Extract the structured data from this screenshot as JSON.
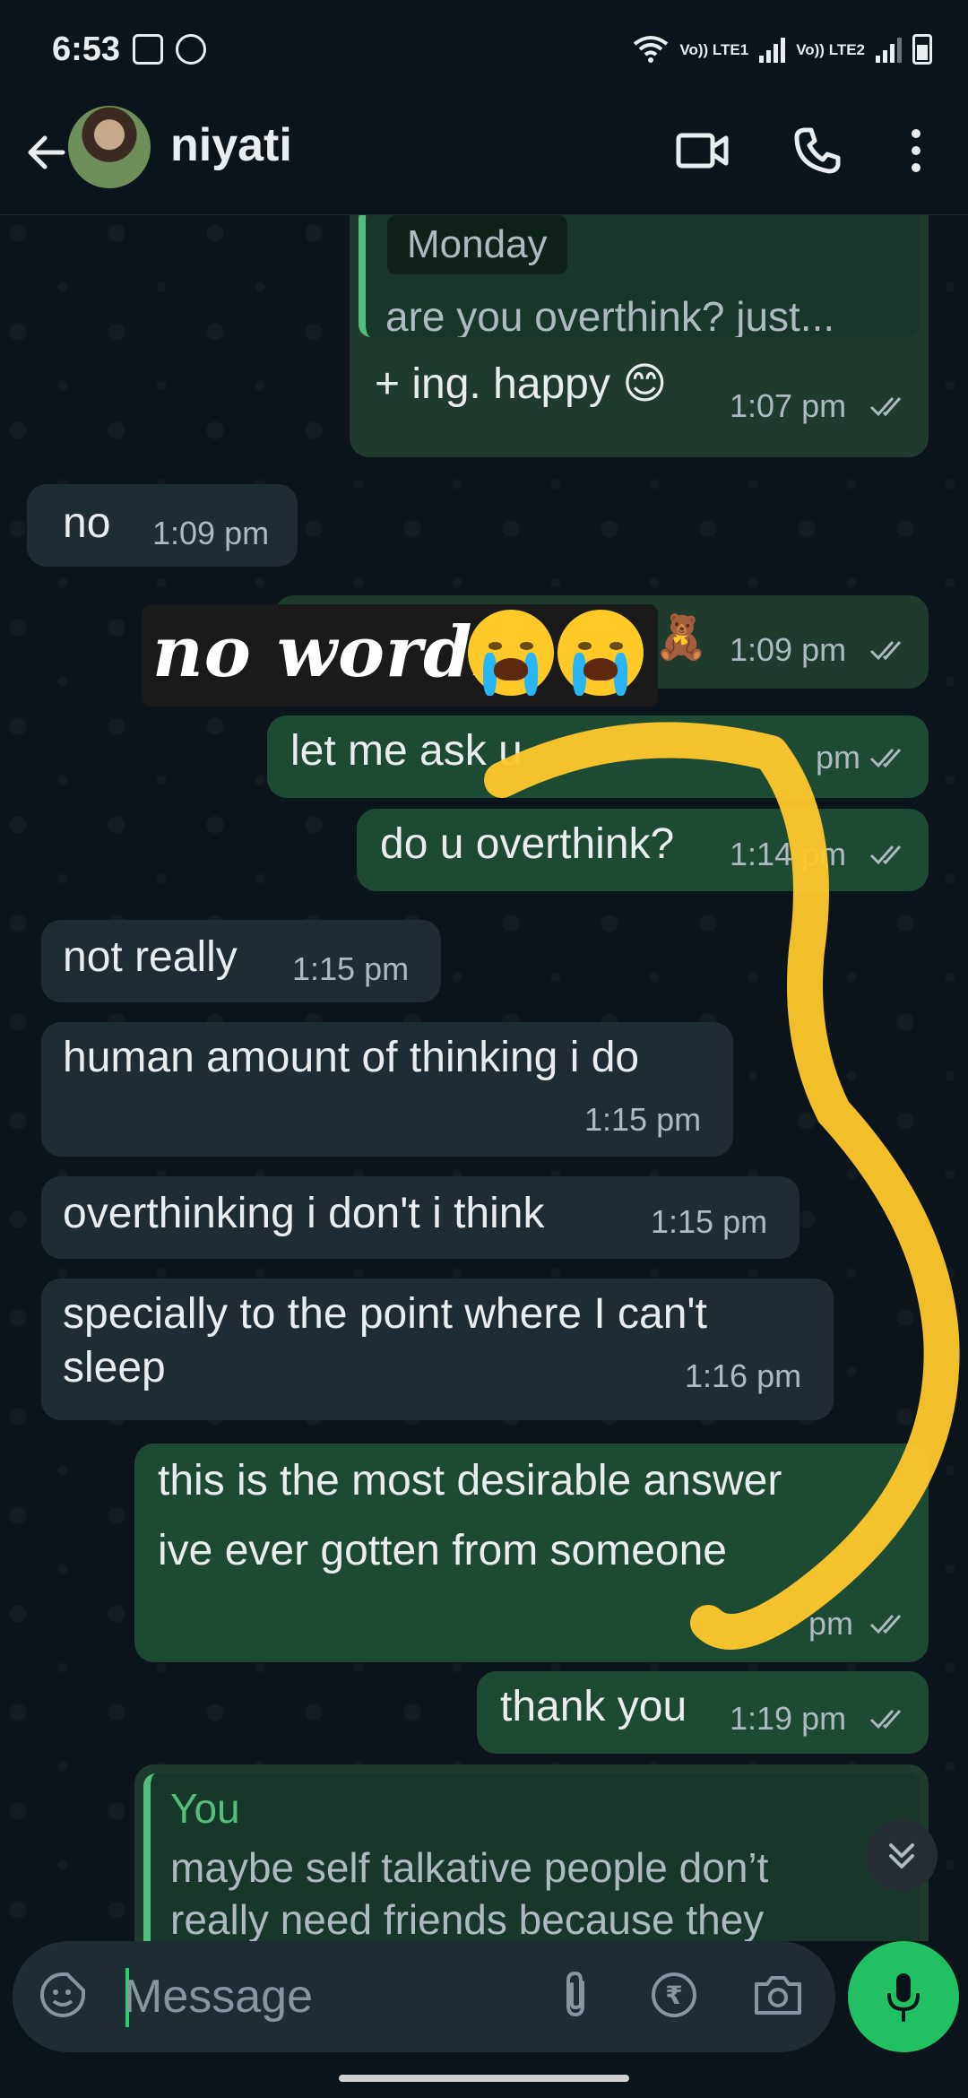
{
  "status_bar": {
    "time": "6:53",
    "sim1": "Vo)) LTE1",
    "sim2": "Vo)) LTE2"
  },
  "header": {
    "contact_name": "niyati",
    "icons": [
      "back-arrow-icon",
      "video-call-icon",
      "phone-icon",
      "more-options-icon"
    ]
  },
  "chat": {
    "messages": [
      {
        "id": "m1",
        "dir": "out",
        "quote_label": "Monday",
        "quote_text": "are you overthink? just...",
        "text": "+ ing. happy 😊",
        "time": "1:07 pm"
      },
      {
        "id": "m2",
        "dir": "in",
        "text": "no",
        "time": "1:09 pm"
      },
      {
        "id": "m3",
        "dir": "out",
        "sticker_text": "no words",
        "text": "🧸",
        "time": "1:09 pm"
      },
      {
        "id": "m4",
        "dir": "out",
        "text": "let me ask u",
        "time": "pm"
      },
      {
        "id": "m5",
        "dir": "out",
        "text": "do u overthink?",
        "time": "1:14 pm"
      },
      {
        "id": "m6",
        "dir": "in",
        "text": "not really",
        "time": "1:15 pm"
      },
      {
        "id": "m7",
        "dir": "in",
        "text": "human amount of thinking i do",
        "time": "1:15 pm"
      },
      {
        "id": "m8",
        "dir": "in",
        "text": "overthinking i don't i think",
        "time": "1:15 pm"
      },
      {
        "id": "m9",
        "dir": "in",
        "text_line1": "specially to the point where I can't",
        "text_line2": "sleep",
        "time": "1:16 pm"
      },
      {
        "id": "m10",
        "dir": "out",
        "text_line1": "this is the most desirable answer",
        "text_line2": "ive ever gotten from someone",
        "time": "pm"
      },
      {
        "id": "m11",
        "dir": "out",
        "text": "thank you",
        "time": "1:19 pm"
      },
      {
        "id": "m12",
        "dir": "out",
        "quote_label": "You",
        "quote_line1": "maybe self talkative people don’t",
        "quote_line2": "really need friends because they"
      }
    ]
  },
  "composer": {
    "placeholder": "Message",
    "icons": [
      "emoji-sticker-icon",
      "attach-icon",
      "rupee-payment-icon",
      "camera-icon",
      "mic-icon"
    ]
  },
  "colors": {
    "background": "#0b141a",
    "outgoing_bubble": "#1f3b2e",
    "incoming_bubble": "#1f2c34",
    "accent_green": "#21c063",
    "scribble_yellow": "#ffc82c"
  }
}
